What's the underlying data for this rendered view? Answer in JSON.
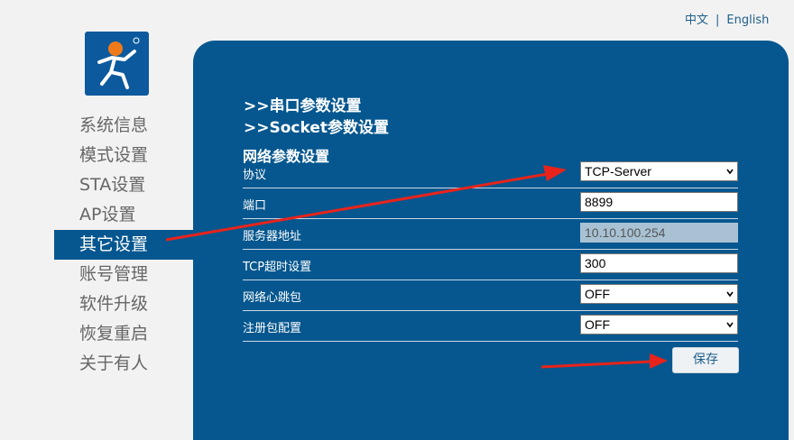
{
  "header": {
    "lang_zh": "中文",
    "lang_sep": "|",
    "lang_en": "English"
  },
  "sidebar": {
    "items": [
      {
        "label": "系统信息"
      },
      {
        "label": "模式设置"
      },
      {
        "label": "STA设置"
      },
      {
        "label": "AP设置"
      },
      {
        "label": "其它设置",
        "active": true
      },
      {
        "label": "账号管理"
      },
      {
        "label": "软件升级"
      },
      {
        "label": "恢复重启"
      },
      {
        "label": "关于有人"
      }
    ]
  },
  "main": {
    "links": [
      ">>串口参数设置",
      ">>Socket参数设置"
    ],
    "section_title": "网络参数设置",
    "rows": [
      {
        "label": "协议",
        "value": "TCP-Server",
        "type": "select"
      },
      {
        "label": "端口",
        "value": "8899",
        "type": "input"
      },
      {
        "label": "服务器地址",
        "value": "10.10.100.254",
        "type": "input-disabled"
      },
      {
        "label": "TCP超时设置",
        "value": "300",
        "type": "input"
      },
      {
        "label": "网络心跳包",
        "value": "OFF",
        "type": "select"
      },
      {
        "label": "注册包配置",
        "value": "OFF",
        "type": "select"
      }
    ],
    "save_label": "保存"
  },
  "colors": {
    "panel": "#06578f",
    "annotation_arrow": "#e8231b"
  }
}
